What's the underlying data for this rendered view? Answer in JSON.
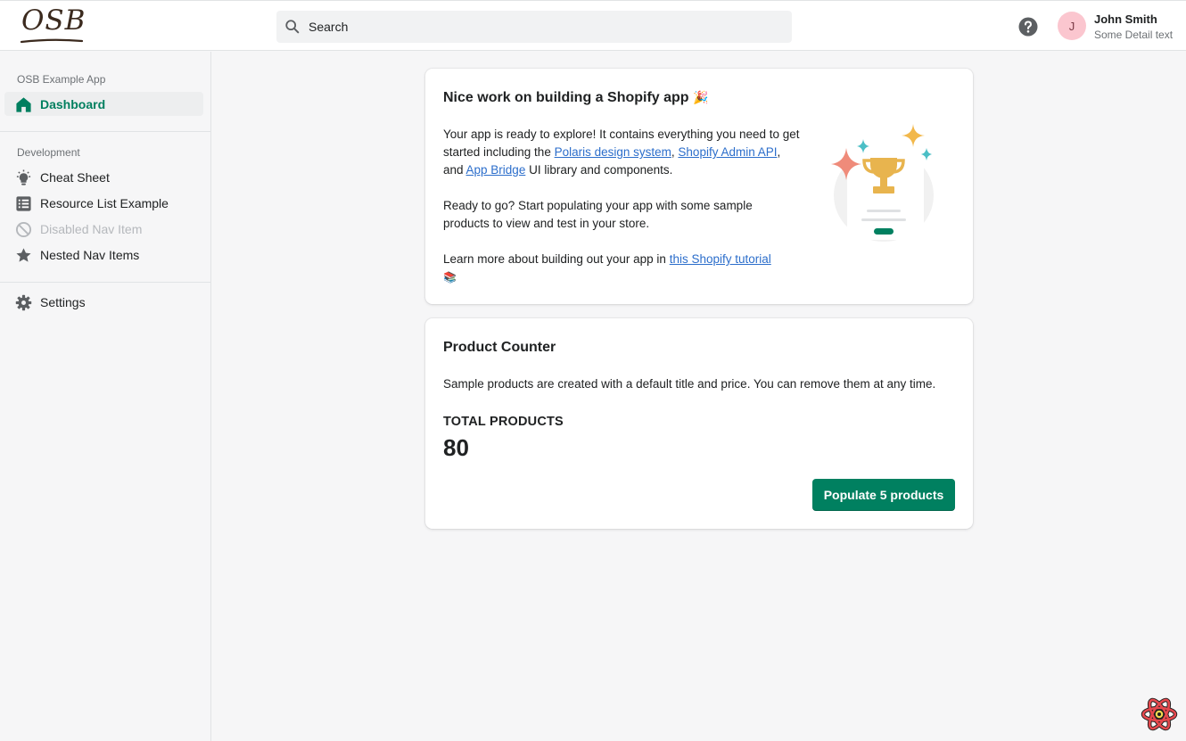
{
  "topbar": {
    "logo_text": "OSB",
    "search_placeholder": "Search",
    "user": {
      "initial": "J",
      "name": "John Smith",
      "detail": "Some Detail text"
    }
  },
  "sidebar": {
    "app_section": "OSB Example App",
    "dashboard": "Dashboard",
    "dev_section": "Development",
    "items": [
      "Cheat Sheet",
      "Resource List Example",
      "Disabled Nav Item",
      "Nested Nav Items"
    ],
    "settings": "Settings"
  },
  "welcome_card": {
    "title": "Nice work on building a Shopify app",
    "title_emoji": "🎉",
    "p1_start": "Your app is ready to explore! It contains everything you need to get started including the ",
    "link_polaris": "Polaris design system",
    "p1_comma": ", ",
    "link_admin_api": "Shopify Admin API",
    "p1_and": ", and ",
    "link_app_bridge": "App Bridge",
    "p1_end": " UI library and components.",
    "p2": "Ready to go? Start populating your app with some sample products to view and test in your store.",
    "p3_start": "Learn more about building out your app in ",
    "link_tutorial": "this Shopify tutorial",
    "p3_emoji": "📚"
  },
  "counter_card": {
    "title": "Product Counter",
    "description": "Sample products are created with a default title and price. You can remove them at any time.",
    "total_label": "TOTAL PRODUCTS",
    "total_value": "80",
    "button_label": "Populate 5 products"
  },
  "colors": {
    "accent": "#008060",
    "active_nav": "#007f5f",
    "link": "#2c6ecb",
    "avatar_bg": "#fbc6cf"
  }
}
